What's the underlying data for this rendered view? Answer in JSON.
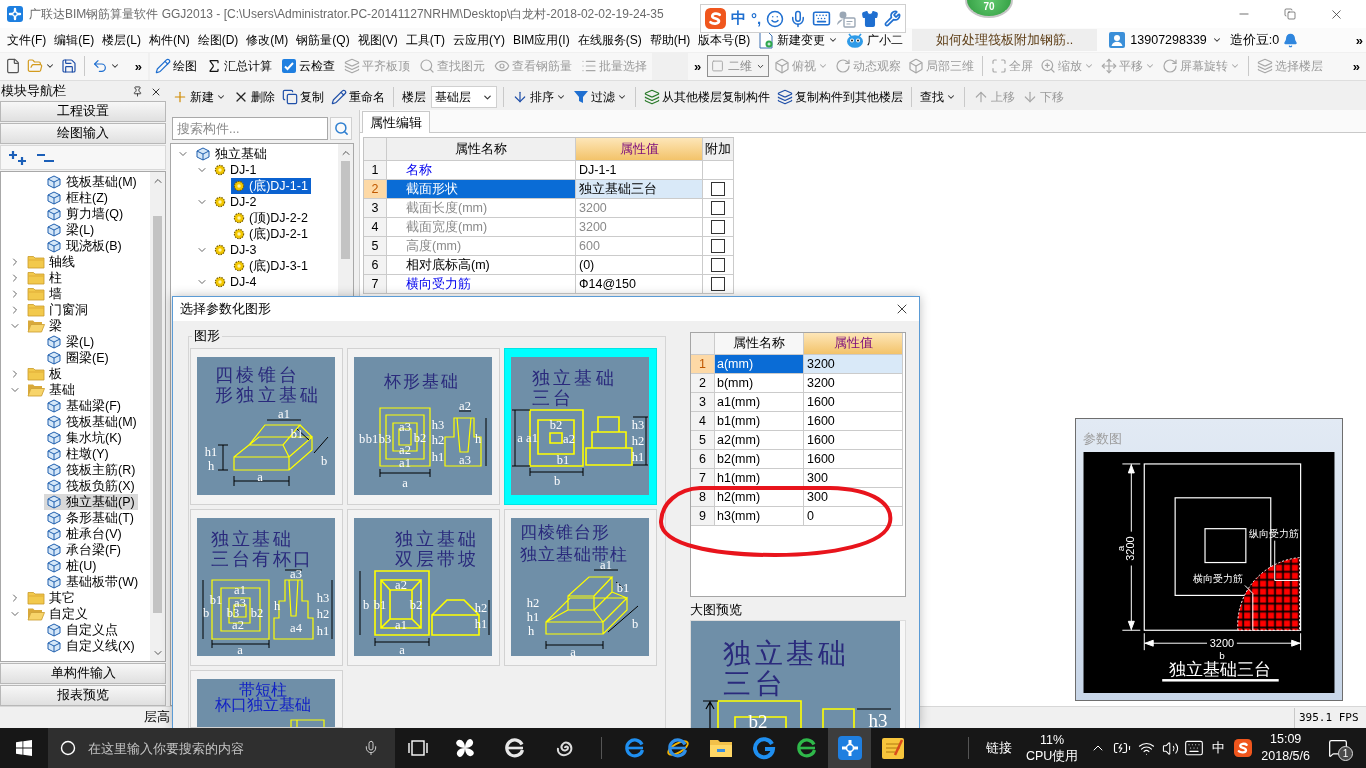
{
  "window": {
    "title": "广联达BIM钢筋算量软件 GGJ2013 - [C:\\Users\\Administrator.PC-20141127NRHM\\Desktop\\白龙村-2018-02-02-19-24-35"
  },
  "ime_toolbar": {
    "mode": "中",
    "punctuation": "°,"
  },
  "floating_badge": {
    "value": "70"
  },
  "menu": [
    "文件(F)",
    "编辑(E)",
    "楼层(L)",
    "构件(N)",
    "绘图(D)",
    "修改(M)",
    "钢筋量(Q)",
    "视图(V)",
    "工具(T)",
    "云应用(Y)",
    "BIM应用(I)",
    "在线服务(S)",
    "帮助(H)",
    "版本号(B)"
  ],
  "menu_actions": [
    {
      "label": "新建变更",
      "dropdown": true
    },
    {
      "label": "广小二",
      "dropdown": false
    }
  ],
  "help_tip": "如何处理筏板附加钢筋..",
  "account": {
    "phone": "13907298339",
    "beans": "造价豆:0",
    "more": "»"
  },
  "toolbar_main": [
    {
      "items": [
        {
          "kind": "icon",
          "dropdown": false,
          "disabled": false
        },
        {
          "kind": "icon",
          "dropdown": true,
          "disabled": false
        },
        {
          "kind": "icon",
          "dropdown": false,
          "disabled": false
        },
        {
          "kind": "separator"
        },
        {
          "kind": "icon",
          "dropdown": true,
          "disabled": false
        },
        {
          "kind": "overflow",
          "label": "»"
        }
      ]
    },
    {
      "items": [
        {
          "kind": "button",
          "label": "绘图",
          "dropdown": false,
          "disabled": false
        },
        {
          "kind": "button",
          "label": "汇总计算",
          "dropdown": false,
          "disabled": false
        },
        {
          "kind": "button",
          "label": "云检查",
          "dropdown": false,
          "disabled": false
        },
        {
          "kind": "button",
          "label": "平齐板顶",
          "dropdown": false,
          "disabled": true
        },
        {
          "kind": "button",
          "label": "查找图元",
          "dropdown": false,
          "disabled": true
        },
        {
          "kind": "button",
          "label": "查看钢筋量",
          "dropdown": false,
          "disabled": true
        },
        {
          "kind": "button",
          "label": "批量选择",
          "dropdown": false,
          "disabled": true
        }
      ]
    },
    {
      "items": [
        {
          "kind": "overflow",
          "label": "»"
        },
        {
          "kind": "select",
          "value": "二维",
          "disabled": true
        },
        {
          "kind": "button",
          "label": "俯视",
          "dropdown": true,
          "disabled": true
        },
        {
          "kind": "button",
          "label": "动态观察",
          "dropdown": false,
          "disabled": true
        },
        {
          "kind": "button",
          "label": "局部三维",
          "dropdown": false,
          "disabled": true
        },
        {
          "kind": "separator"
        },
        {
          "kind": "button",
          "label": "全屏",
          "dropdown": false,
          "disabled": true
        },
        {
          "kind": "button",
          "label": "缩放",
          "dropdown": true,
          "disabled": true
        },
        {
          "kind": "button",
          "label": "平移",
          "dropdown": true,
          "disabled": true
        },
        {
          "kind": "button",
          "label": "屏幕旋转",
          "dropdown": true,
          "disabled": true
        },
        {
          "kind": "separator"
        },
        {
          "kind": "button",
          "label": "选择楼层",
          "dropdown": false,
          "disabled": true
        },
        {
          "kind": "overflow",
          "label": "»"
        }
      ]
    }
  ],
  "toolbar_components": [
    {
      "kind": "button",
      "label": "新建",
      "dropdown": true,
      "disabled": false
    },
    {
      "kind": "button",
      "label": "删除",
      "dropdown": false,
      "disabled": false
    },
    {
      "kind": "button",
      "label": "复制",
      "dropdown": false,
      "disabled": false
    },
    {
      "kind": "button",
      "label": "重命名",
      "dropdown": false,
      "disabled": false
    },
    {
      "kind": "separator"
    },
    {
      "kind": "label",
      "label": "楼层"
    },
    {
      "kind": "select",
      "value": "基础层",
      "disabled": false
    },
    {
      "kind": "separator"
    },
    {
      "kind": "button",
      "label": "排序",
      "dropdown": true,
      "disabled": false
    },
    {
      "kind": "button",
      "label": "过滤",
      "dropdown": true,
      "disabled": false
    },
    {
      "kind": "separator"
    },
    {
      "kind": "button",
      "label": "从其他楼层复制构件",
      "dropdown": false,
      "disabled": false
    },
    {
      "kind": "button",
      "label": "复制构件到其他楼层",
      "dropdown": false,
      "disabled": false
    },
    {
      "kind": "separator"
    },
    {
      "kind": "button",
      "label": "查找",
      "dropdown": true,
      "disabled": false
    },
    {
      "kind": "separator"
    },
    {
      "kind": "button",
      "label": "上移",
      "dropdown": false,
      "disabled": true
    },
    {
      "kind": "button",
      "label": "下移",
      "dropdown": false,
      "disabled": true
    }
  ],
  "nav": {
    "title": "模块导航栏",
    "top_sections": [
      "工程设置",
      "绘图输入"
    ],
    "tree": {
      "partial_group": [
        {
          "label": "筏板基础(M)",
          "selected": false
        },
        {
          "label": "框柱(Z)",
          "selected": false
        },
        {
          "label": "剪力墙(Q)",
          "selected": false
        },
        {
          "label": "梁(L)",
          "selected": false
        },
        {
          "label": "现浇板(B)",
          "selected": false
        }
      ],
      "folders": [
        {
          "label": "轴线",
          "expanded": false
        },
        {
          "label": "柱",
          "expanded": false
        },
        {
          "label": "墙",
          "expanded": false
        },
        {
          "label": "门窗洞",
          "expanded": false
        },
        {
          "label": "梁",
          "expanded": true,
          "children": [
            {
              "label": "梁(L)",
              "selected": false
            },
            {
              "label": "圈梁(E)",
              "selected": false
            }
          ]
        },
        {
          "label": "板",
          "expanded": false
        },
        {
          "label": "基础",
          "expanded": true,
          "children": [
            {
              "label": "基础梁(F)",
              "selected": false
            },
            {
              "label": "筏板基础(M)",
              "selected": false
            },
            {
              "label": "集水坑(K)",
              "selected": false
            },
            {
              "label": "柱墩(Y)",
              "selected": false
            },
            {
              "label": "筏板主筋(R)",
              "selected": false
            },
            {
              "label": "筏板负筋(X)",
              "selected": false
            },
            {
              "label": "独立基础(P)",
              "selected": true
            },
            {
              "label": "条形基础(T)",
              "selected": false
            },
            {
              "label": "桩承台(V)",
              "selected": false
            },
            {
              "label": "承台梁(F)",
              "selected": false
            },
            {
              "label": "桩(U)",
              "selected": false
            },
            {
              "label": "基础板带(W)",
              "selected": false
            }
          ]
        },
        {
          "label": "其它",
          "expanded": false
        },
        {
          "label": "自定义",
          "expanded": true,
          "children": [
            {
              "label": "自定义点",
              "selected": false
            },
            {
              "label": "自定义线(X)",
              "selected": false
            }
          ]
        }
      ]
    },
    "bottom_sections": [
      "单构件输入",
      "报表预览"
    ]
  },
  "component_panel": {
    "search": {
      "placeholder": "搜索构件..."
    },
    "tree": [
      {
        "label": "独立基础",
        "expanded": true,
        "children": [
          {
            "label": "DJ-1",
            "expanded": true,
            "children": [
              {
                "label": "(底)DJ-1-1",
                "selected": true
              }
            ]
          },
          {
            "label": "DJ-2",
            "expanded": true,
            "children": [
              {
                "label": "(顶)DJ-2-2",
                "selected": false
              },
              {
                "label": "(底)DJ-2-1",
                "selected": false
              }
            ]
          },
          {
            "label": "DJ-3",
            "expanded": true,
            "children": [
              {
                "label": "(底)DJ-3-1",
                "selected": false
              }
            ]
          },
          {
            "label": "DJ-4",
            "expanded": true
          }
        ]
      }
    ]
  },
  "properties": {
    "tab": "属性编辑",
    "columns": [
      "属性名称",
      "属性值",
      "附加"
    ],
    "rows": [
      {
        "index": "1",
        "name": "名称",
        "value": "DJ-1-1",
        "kind": "public",
        "selected": false
      },
      {
        "index": "2",
        "name": "截面形状",
        "value": "独立基础三台",
        "kind": "private",
        "selected": true,
        "checked": false
      },
      {
        "index": "3",
        "name": "截面长度(mm)",
        "value": "3200",
        "kind": "readonly",
        "selected": false,
        "checked": false
      },
      {
        "index": "4",
        "name": "截面宽度(mm)",
        "value": "3200",
        "kind": "readonly",
        "selected": false,
        "checked": false
      },
      {
        "index": "5",
        "name": "高度(mm)",
        "value": "600",
        "kind": "readonly",
        "selected": false,
        "checked": false
      },
      {
        "index": "6",
        "name": "相对底标高(m)",
        "value": "(0)",
        "kind": "private",
        "selected": false,
        "checked": false
      },
      {
        "index": "7",
        "name": "横向受力筋",
        "value": "Ф14@150",
        "kind": "public",
        "selected": false,
        "checked": false
      }
    ]
  },
  "param_figure": {
    "title": "参数图",
    "dim_a": {
      "value": "3200",
      "name": "a"
    },
    "dim_b": {
      "value": "3200",
      "name": "b"
    },
    "callouts": [
      "纵向受力筋",
      "横向受力筋"
    ],
    "caption": "独立基础三台"
  },
  "status_bar": {
    "text": "层高",
    "fps": "395.1 FPS"
  },
  "dialog": {
    "title": "选择参数化图形",
    "group": "图形",
    "shapes": [
      {
        "kind": "pyramid",
        "title": [
          "四棱锥台",
          "形独立基础"
        ],
        "labels": [
          "a1",
          "b1",
          "h1",
          "h",
          "b",
          "a"
        ],
        "selected": false
      },
      {
        "kind": "cup",
        "title": [
          "杯形基础"
        ],
        "labels": [
          "b",
          "b1",
          "b3",
          "a3",
          "b2",
          "a2",
          "a1",
          "a",
          "a2",
          "h3",
          "h2",
          "h1",
          "h",
          "a3"
        ],
        "selected": false
      },
      {
        "kind": "three-step",
        "title": [
          "独立基础",
          "三台"
        ],
        "labels": [
          "a",
          "a1",
          "b2",
          "a2",
          "b1",
          "b",
          "h3",
          "h2",
          "h1"
        ],
        "selected": true
      },
      {
        "kind": "three-step-cup",
        "title": [
          "独立基础",
          "三台有杯口"
        ],
        "labels": [
          "b1",
          "a1",
          "a3",
          "b",
          "b3",
          "b2",
          "a2",
          "a",
          "a3",
          "h",
          "a4",
          "h3",
          "h2",
          "h1"
        ],
        "selected": false
      },
      {
        "kind": "double-slope",
        "title": [
          "独立基础",
          "双层带坡"
        ],
        "labels": [
          "b",
          "b1",
          "a2",
          "b2",
          "a1",
          "a",
          "h2",
          "h1"
        ],
        "selected": false
      },
      {
        "kind": "pyramid-column",
        "title": [
          "四棱锥台形",
          "独立基础带柱"
        ],
        "labels": [
          "a1",
          "b1",
          "h2",
          "h1",
          "h",
          "b",
          "a"
        ],
        "selected": false
      },
      {
        "kind": "short-column-cup",
        "title": [
          "带短柱",
          "杯口独立基础"
        ],
        "selected": false
      }
    ],
    "table": {
      "columns": [
        "属性名称",
        "属性值"
      ],
      "rows": [
        {
          "index": "1",
          "name": "a(mm)",
          "value": "3200",
          "selected": true
        },
        {
          "index": "2",
          "name": "b(mm)",
          "value": "3200",
          "selected": false
        },
        {
          "index": "3",
          "name": "a1(mm)",
          "value": "1600",
          "selected": false
        },
        {
          "index": "4",
          "name": "b1(mm)",
          "value": "1600",
          "selected": false
        },
        {
          "index": "5",
          "name": "a2(mm)",
          "value": "1600",
          "selected": false
        },
        {
          "index": "6",
          "name": "b2(mm)",
          "value": "1600",
          "selected": false
        },
        {
          "index": "7",
          "name": "h1(mm)",
          "value": "300",
          "selected": false
        },
        {
          "index": "8",
          "name": "h2(mm)",
          "value": "300",
          "selected": false
        },
        {
          "index": "9",
          "name": "h3(mm)",
          "value": "0",
          "selected": false
        }
      ]
    },
    "preview": {
      "label": "大图预览",
      "title": [
        "独立基础",
        "三台"
      ],
      "labels": [
        "b2",
        "h3"
      ]
    }
  },
  "taskbar": {
    "search_placeholder": "在这里输入你要搜索的内容",
    "running": [
      {
        "active": false
      },
      {
        "active": false
      },
      {
        "active": false
      },
      {
        "active": false
      },
      {
        "active": false
      },
      {
        "active": true
      },
      {
        "active": false
      }
    ],
    "tray": {
      "links": "链接",
      "cpu_value": "11%",
      "cpu_label": "CPU使用",
      "ime": "中",
      "time": "15:09",
      "date": "2018/5/6",
      "notifications": "1"
    }
  }
}
